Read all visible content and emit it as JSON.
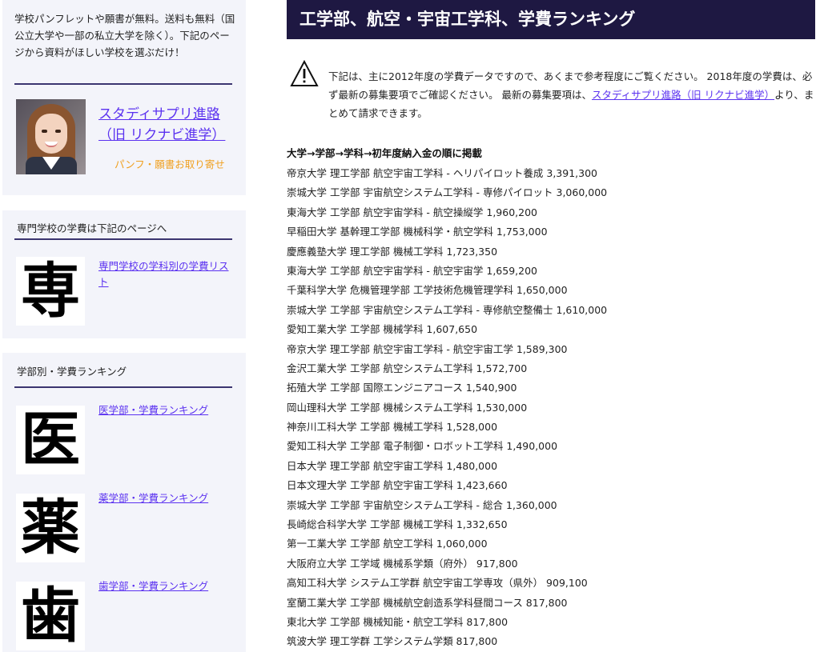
{
  "sidebar": {
    "intro_text": "学校パンフレットや願書が無料。送料も無料（国公立大学や一部の私立大学を除く）。下記のページから資料がほしい学校を選ぶだけ！",
    "study_link": "スタディサプリ進路（旧 リクナビ進学）",
    "pamphlet_label": "パンフ・願書お取り寄せ",
    "senmon": {
      "title": "専門学校の学費は下記のページへ",
      "kanji": "専",
      "link": "専門学校の学科別の学費リスト"
    },
    "faculty": {
      "title": "学部別・学費ランキング",
      "items": [
        {
          "kanji": "医",
          "link": "医学部・学費ランキング"
        },
        {
          "kanji": "薬",
          "link": "薬学部・学費ランキング"
        },
        {
          "kanji": "歯",
          "link": "歯学部・学費ランキング"
        }
      ]
    }
  },
  "main": {
    "title": "工学部、航空・宇宙工学科、学費ランキング",
    "notice_before": "下記は、主に2012年度の学費データですので、あくまで参考程度にご覧ください。 2018年度の学費は、必ず最新の募集要項でご確認ください。 最新の募集要項は、",
    "notice_link": "スタディサプリ進路（旧 リクナビ進学）",
    "notice_after": "より、まとめて請求できます。",
    "list_heading": "大学→学部→学科→初年度納入金の順に掲載",
    "rankings": [
      "帝京大学 理工学部 航空宇宙工学科 - ヘリパイロット養成 3,391,300",
      "崇城大学 工学部 宇宙航空システム工学科 - 専修パイロット 3,060,000",
      "東海大学 工学部 航空宇宙学科 - 航空操縦学 1,960,200",
      "早稲田大学 基幹理工学部 機械科学・航空学科 1,753,000",
      "慶應義塾大学 理工学部 機械工学科 1,723,350",
      "東海大学 工学部 航空宇宙学科 - 航空宇宙学 1,659,200",
      "千葉科学大学 危機管理学部 工学技術危機管理学科 1,650,000",
      "崇城大学 工学部 宇宙航空システム工学科 - 専修航空整備士 1,610,000",
      "愛知工業大学 工学部 機械学科 1,607,650",
      "帝京大学 理工学部 航空宇宙工学科 - 航空宇宙工学 1,589,300",
      "金沢工業大学 工学部 航空システム工学科 1,572,700",
      "拓殖大学 工学部 国際エンジニアコース 1,540,900",
      "岡山理科大学 工学部 機械システム工学科 1,530,000",
      "神奈川工科大学 工学部 機械工学科 1,528,000",
      "愛知工科大学 工学部 電子制御・ロボット工学科 1,490,000",
      "日本大学 理工学部 航空宇宙工学科 1,480,000",
      "日本文理大学 工学部 航空宇宙工学科 1,423,660",
      "崇城大学 工学部 宇宙航空システム工学科 - 総合 1,360,000",
      "長崎総合科学大学 工学部 機械工学科 1,332,650",
      "第一工業大学 工学部 航空工学科 1,060,000",
      "大阪府立大学 工学域 機械系学類（府外） 917,800",
      "高知工科大学 システム工学群 航空宇宙工学専攻（県外） 909,100",
      "室蘭工業大学 工学部 機械航空創造系学科昼間コース 817,800",
      "東北大学 工学部 機械知能・航空工学科 817,800",
      "筑波大学 理工学群 工学システム学類 817,800"
    ]
  },
  "colors": {
    "header_bg": "#1e1842",
    "sidebar_bg": "#f3f4fa",
    "link": "#5b32f0",
    "accent_orange": "#f0a020",
    "divider": "#3b3570"
  }
}
